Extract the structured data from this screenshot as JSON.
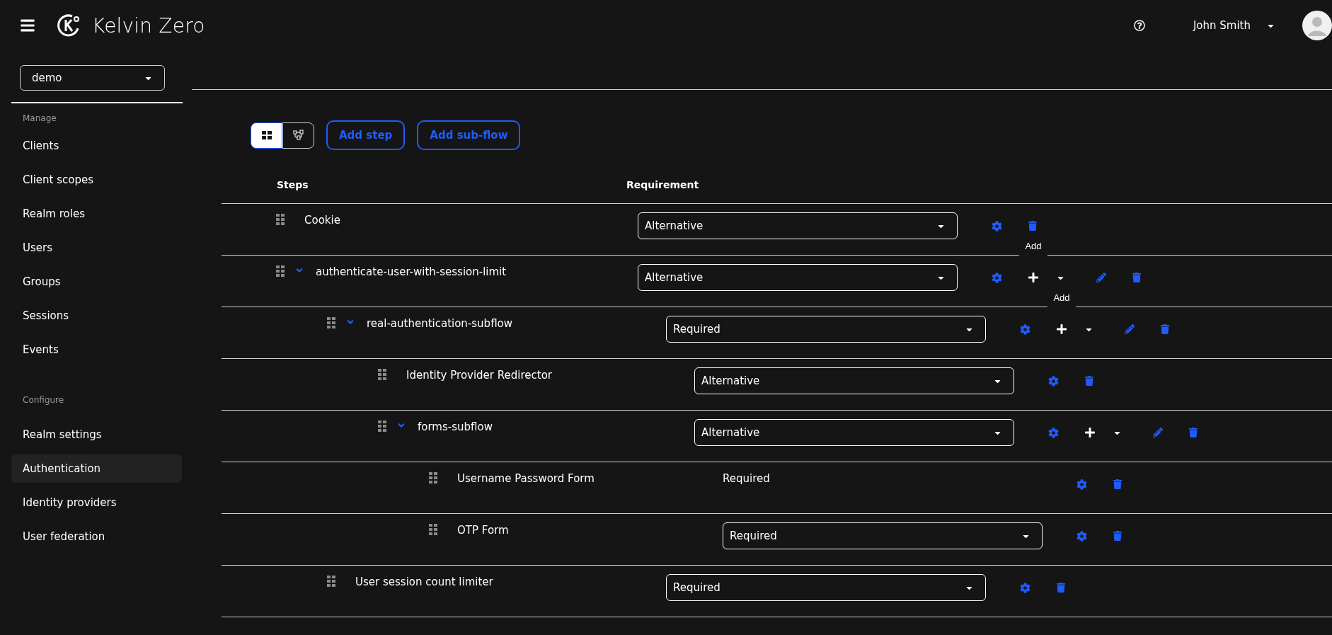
{
  "header": {
    "brand": "Kelvin Zero",
    "user": "John Smith"
  },
  "sidebar": {
    "realm": "demo",
    "sections": [
      {
        "title": "Manage",
        "items": [
          {
            "label": "Clients",
            "selected": false
          },
          {
            "label": "Client scopes",
            "selected": false
          },
          {
            "label": "Realm roles",
            "selected": false
          },
          {
            "label": "Users",
            "selected": false
          },
          {
            "label": "Groups",
            "selected": false
          },
          {
            "label": "Sessions",
            "selected": false
          },
          {
            "label": "Events",
            "selected": false
          }
        ]
      },
      {
        "title": "Configure",
        "items": [
          {
            "label": "Realm settings",
            "selected": false
          },
          {
            "label": "Authentication",
            "selected": true
          },
          {
            "label": "Identity providers",
            "selected": false
          },
          {
            "label": "User federation",
            "selected": false
          }
        ]
      }
    ]
  },
  "toolbar": {
    "views": [
      {
        "kind": "table",
        "selected": true
      },
      {
        "kind": "diagram",
        "selected": false
      }
    ],
    "buttons": [
      "Add step",
      "Add sub-flow"
    ]
  },
  "table": {
    "columns": [
      "Steps",
      "Requirement"
    ],
    "rows": [
      {
        "name": "Cookie",
        "kind": "step",
        "requirement": "Alternative",
        "editable": true
      },
      {
        "name": "authenticate-user-with-session-limit",
        "kind": "flow",
        "expanded": true,
        "requirement": "Alternative",
        "editable": true,
        "tooltip": "Add",
        "children": [
          {
            "name": "real-authentication-subflow",
            "kind": "flow",
            "expanded": true,
            "requirement": "Required",
            "editable": true,
            "tooltip": "Add",
            "children": [
              {
                "name": "Identity Provider Redirector",
                "kind": "step",
                "requirement": "Alternative",
                "editable": true
              },
              {
                "name": "forms-subflow",
                "kind": "flow",
                "expanded": true,
                "requirement": "Alternative",
                "editable": true,
                "children": [
                  {
                    "name": "Username Password Form",
                    "kind": "step",
                    "requirement": "Required",
                    "editable": false
                  },
                  {
                    "name": "OTP Form",
                    "kind": "step",
                    "requirement": "Required",
                    "editable": true
                  }
                ]
              }
            ]
          },
          {
            "name": "User session count limiter",
            "kind": "step",
            "requirement": "Required",
            "editable": true
          }
        ]
      }
    ]
  }
}
